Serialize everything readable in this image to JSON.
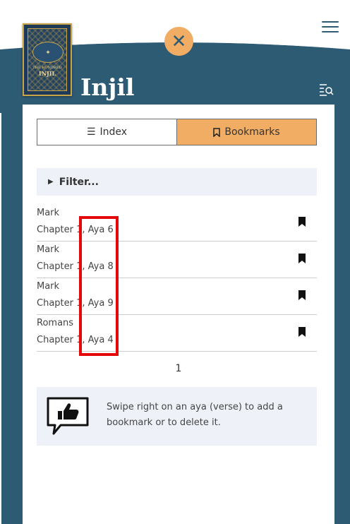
{
  "book": {
    "cover_title_small": "THE HUNDRED",
    "cover_title": "INJIL",
    "app_title": "Injil"
  },
  "tabs": [
    {
      "label": "Index",
      "icon": "list-icon",
      "active": false
    },
    {
      "label": "Bookmarks",
      "icon": "bookmark-outline-icon",
      "active": true
    }
  ],
  "filter": {
    "label": "Filter..."
  },
  "bookmarks": [
    {
      "book": "Mark",
      "ref": "Chapter 1, Aya 6"
    },
    {
      "book": "Mark",
      "ref": "Chapter 1, Aya 8"
    },
    {
      "book": "Mark",
      "ref": "Chapter 1, Aya 9"
    },
    {
      "book": "Romans",
      "ref": "Chapter 1, Aya 4"
    }
  ],
  "pagination": {
    "current": "1"
  },
  "tip": {
    "text": "Swipe right on an aya (verse) to add a bookmark or to delete it."
  },
  "colors": {
    "header": "#2e5b74",
    "accent": "#f0ad63",
    "panel_tint": "#eef2f8",
    "highlight": "#e4080a"
  }
}
